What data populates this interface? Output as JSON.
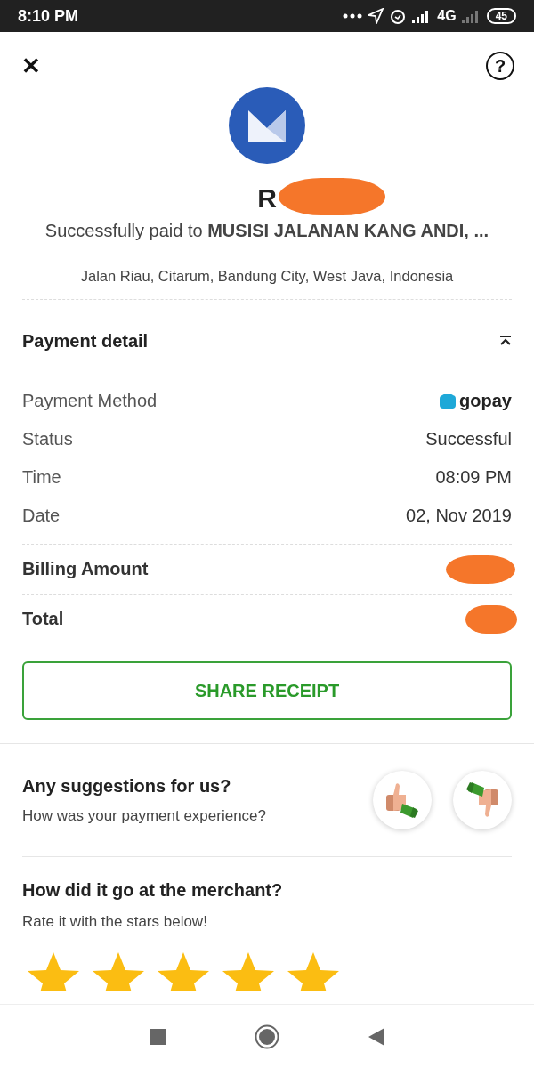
{
  "status_bar": {
    "time": "8:10 PM",
    "network": "4G",
    "battery": "45"
  },
  "header": {
    "close": "✕",
    "help": "?"
  },
  "receipt": {
    "amount": "R",
    "amount_redacted": true,
    "message": "Successfully paid to **MUSISI JALANAN KANG ANDI, ...**",
    "address": "Jalan Riau, Citarum, Bandung City, West Java, Indonesia"
  },
  "payment_detail": {
    "title": "Payment detail",
    "expanded": true,
    "rows": [
      {
        "kind": "method",
        "label": "Payment Method",
        "value": "gopay"
      },
      {
        "kind": "text",
        "label": "Status",
        "value": "Successful"
      },
      {
        "kind": "text",
        "label": "Time",
        "value": "08:09 PM"
      },
      {
        "kind": "text",
        "label": "Date",
        "value": "02, Nov 2019"
      }
    ],
    "totals": [
      {
        "label": "Billing Amount",
        "redacted": true
      },
      {
        "label": "Total",
        "redacted": true
      }
    ]
  },
  "share_button": "SHARE RECEIPT",
  "feedback": {
    "title": "Any suggestions for us?",
    "subtitle": "How was your payment experience?"
  },
  "merchant_rating": {
    "title": "How did it go at the merchant?",
    "subtitle": "Rate it with the stars below!",
    "stars": 5
  }
}
